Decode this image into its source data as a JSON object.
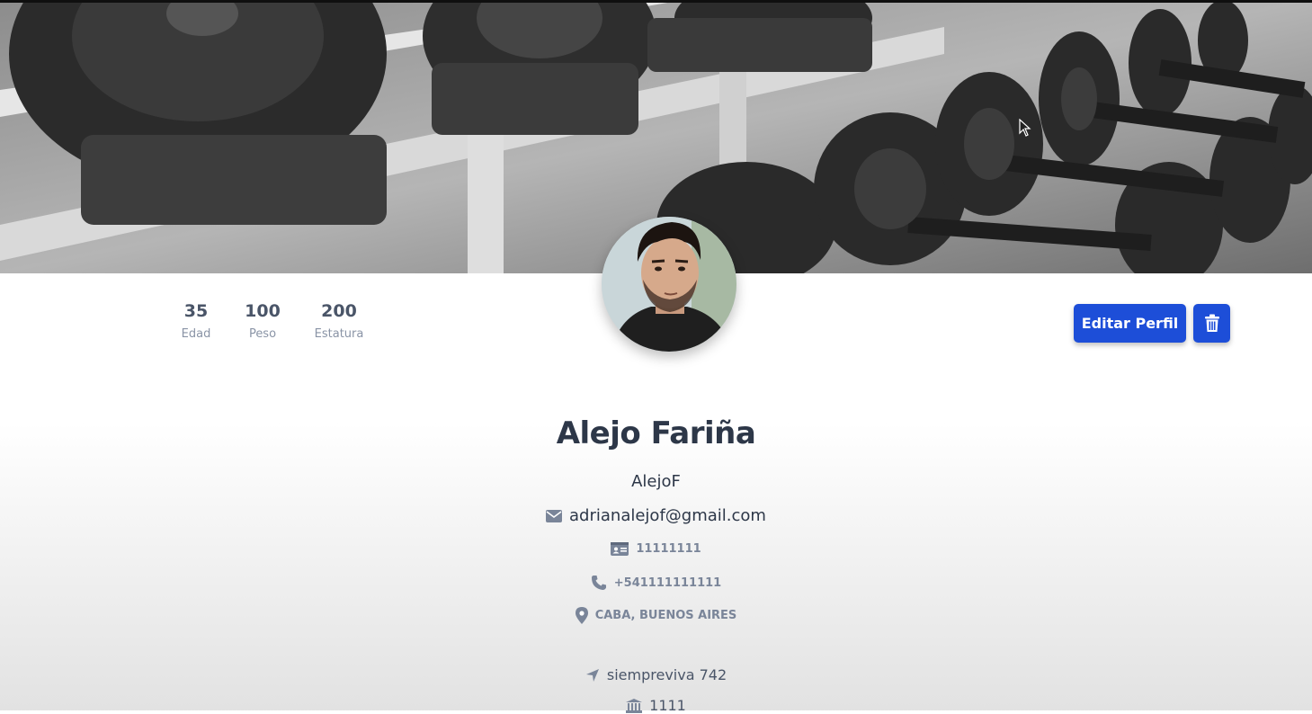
{
  "stats": [
    {
      "value": "35",
      "label": "Edad"
    },
    {
      "value": "100",
      "label": "Peso"
    },
    {
      "value": "200",
      "label": "Estatura"
    }
  ],
  "actions": {
    "edit_label": "Editar Perfil",
    "delete_icon": "trash-icon"
  },
  "profile": {
    "full_name": "Alejo Fariña",
    "username": "AlejoF",
    "email": "adrianalejof@gmail.com",
    "dni": "11111111",
    "phone": "+541111111111",
    "location": "CABA, BUENOS AIRES",
    "address": "siempreviva 742",
    "postal": "1111"
  },
  "icons": {
    "email": "envelope-icon",
    "dni": "id-card-icon",
    "phone": "phone-icon",
    "location": "map-pin-icon",
    "address": "location-arrow-icon",
    "postal": "bank-icon"
  },
  "colors": {
    "accent": "#1d4ed8",
    "text": "#2d3748",
    "muted": "#7a8599"
  }
}
